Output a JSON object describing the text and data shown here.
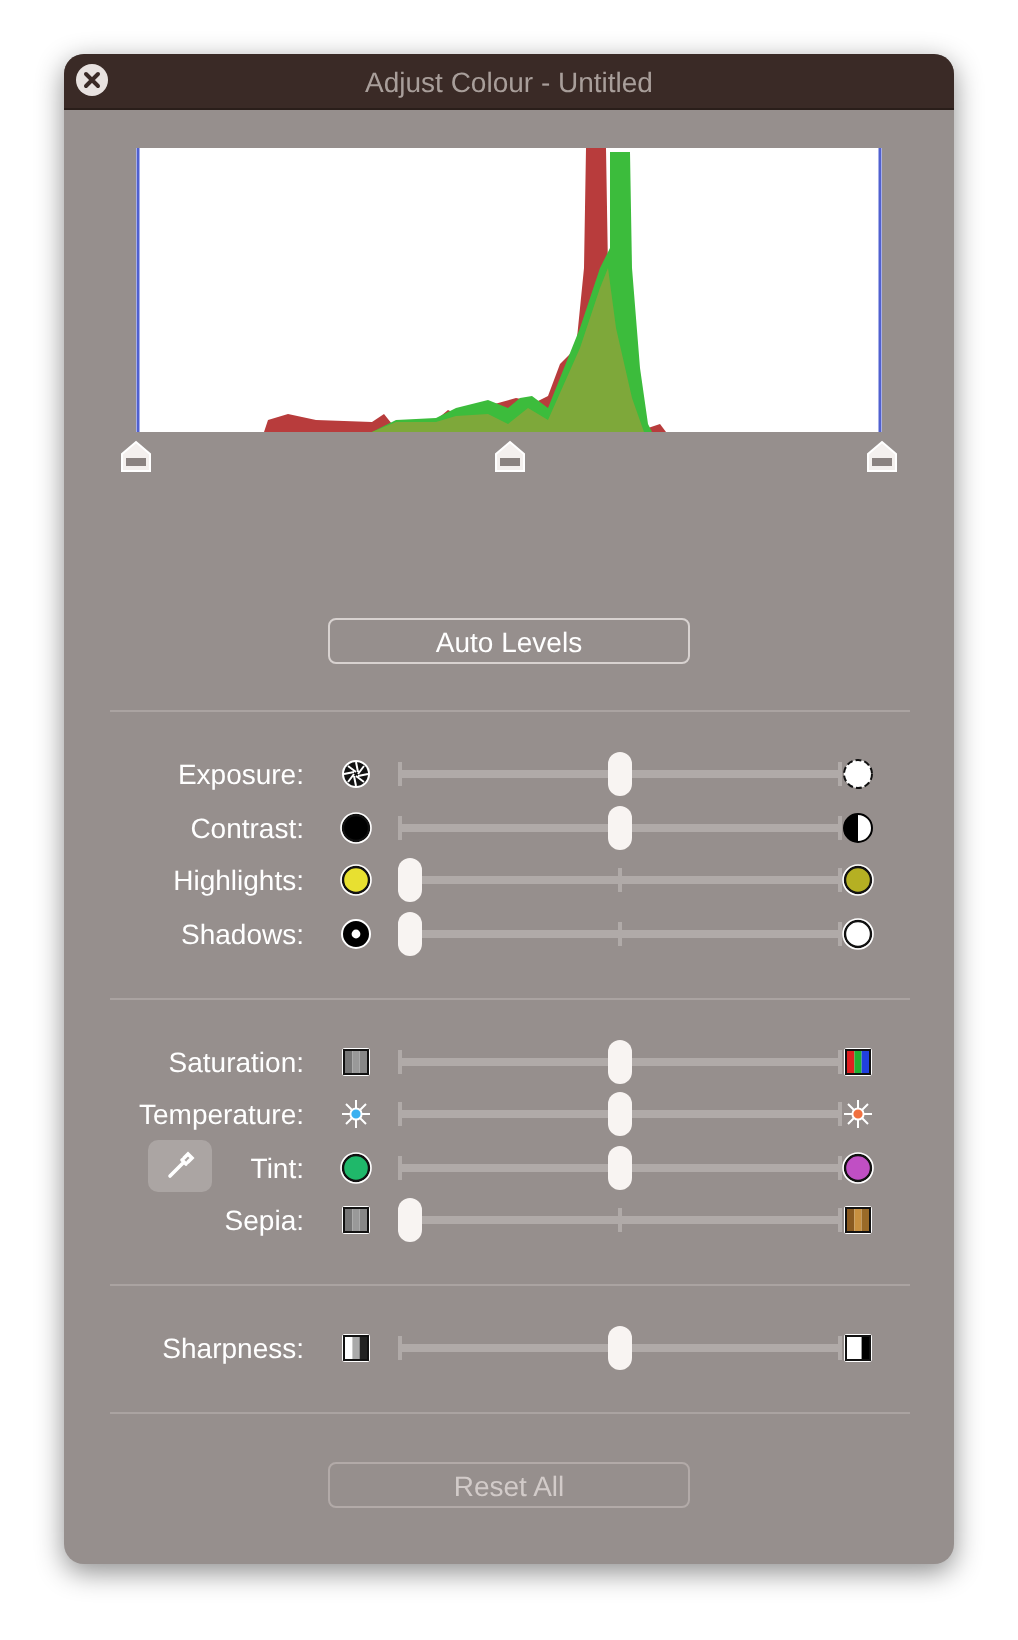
{
  "window": {
    "title": "Adjust Colour - Untitled"
  },
  "auto_levels_button": {
    "label": "Auto Levels",
    "disabled": false
  },
  "groups": [
    {
      "rows": [
        {
          "label": "Exposure:",
          "icons": [
            {
              "kind": "aperture-closed"
            },
            {
              "kind": "aperture-open"
            }
          ],
          "level": 0.5
        },
        {
          "label": "Contrast:",
          "icons": [
            {
              "kind": "black-circle"
            },
            {
              "kind": "half-circle"
            }
          ],
          "level": 0.5
        },
        {
          "label": "Highlights:",
          "icons": [
            {
              "kind": "yellow-circle"
            },
            {
              "kind": "olive-circle"
            }
          ],
          "level": 0
        },
        {
          "label": "Shadows:",
          "icons": [
            {
              "kind": "ring-black"
            },
            {
              "kind": "white-circle"
            }
          ],
          "level": 0
        }
      ]
    },
    {
      "rows": [
        {
          "label": "Saturation:",
          "icons": [
            {
              "kind": "grey-swatch"
            },
            {
              "kind": "rgb-swatch"
            }
          ],
          "level": 0.5
        },
        {
          "label": "Temperature:",
          "icons": [
            {
              "kind": "sun-blue"
            },
            {
              "kind": "sun-orange"
            }
          ],
          "level": 0.5
        },
        {
          "label": "Tint:",
          "icons": [
            {
              "kind": "green-circle"
            },
            {
              "kind": "magenta-circle"
            }
          ],
          "level": 0.5,
          "eyedropper": true
        },
        {
          "label": "Sepia:",
          "icons": [
            {
              "kind": "grey-swatch"
            },
            {
              "kind": "sepia-swatch"
            }
          ],
          "level": 0
        }
      ]
    },
    {
      "rows": [
        {
          "label": "Sharpness:",
          "icons": [
            {
              "kind": "soft-swatch"
            },
            {
              "kind": "sharp-swatch"
            }
          ],
          "level": 0.5
        }
      ]
    }
  ],
  "reset_button": {
    "label": "Reset All",
    "disabled": true
  }
}
